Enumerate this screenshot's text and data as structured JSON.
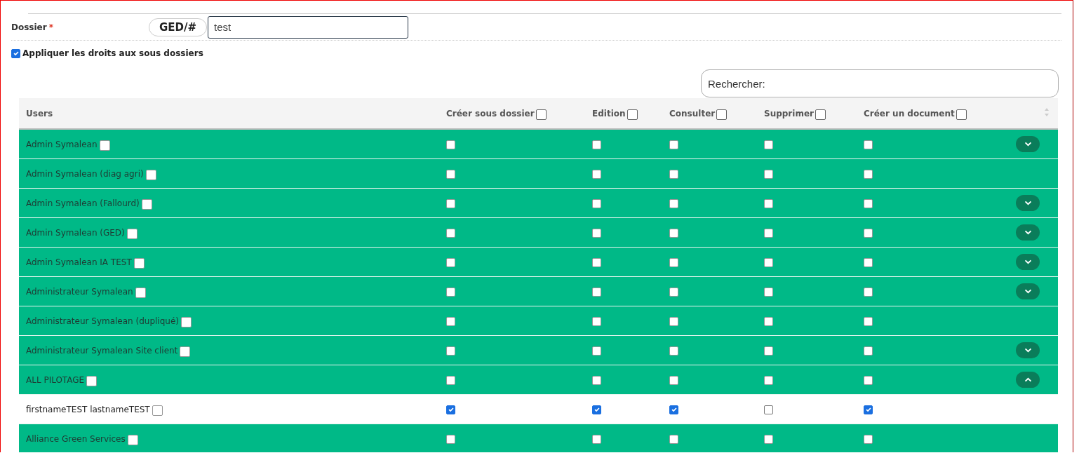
{
  "folder": {
    "label": "Dossier",
    "required_mark": "*",
    "prefix": "GED/#",
    "value": "test"
  },
  "apply_subfolders": {
    "label": "Appliquer les droits aux sous dossiers",
    "checked": true
  },
  "search": {
    "placeholder": "Rechercher:"
  },
  "table": {
    "columns": [
      {
        "label": "Users",
        "kind": "name"
      },
      {
        "label": "Créer sous dossier",
        "checked": false,
        "kind": "perm"
      },
      {
        "label": "Edition",
        "checked": false,
        "kind": "perm"
      },
      {
        "label": "Consulter",
        "checked": false,
        "kind": "perm"
      },
      {
        "label": "Supprimer",
        "checked": false,
        "kind": "perm"
      },
      {
        "label": "Créer un document",
        "checked": false,
        "kind": "perm"
      }
    ],
    "rows": [
      {
        "name": "Admin Symalean",
        "kind": "group",
        "checked": false,
        "perms": [
          false,
          false,
          false,
          false,
          false
        ],
        "expanded": false
      },
      {
        "name": "Admin Symalean (diag agri)",
        "kind": "group",
        "checked": false,
        "perms": [
          false,
          false,
          false,
          false,
          false
        ]
      },
      {
        "name": "Admin Symalean (Fallourd)",
        "kind": "group",
        "checked": false,
        "perms": [
          false,
          false,
          false,
          false,
          false
        ],
        "expanded": false
      },
      {
        "name": "Admin Symalean (GED)",
        "kind": "group",
        "checked": false,
        "perms": [
          false,
          false,
          false,
          false,
          false
        ],
        "expanded": false
      },
      {
        "name": "Admin Symalean IA TEST",
        "kind": "group",
        "checked": false,
        "perms": [
          false,
          false,
          false,
          false,
          false
        ],
        "expanded": false
      },
      {
        "name": "Administrateur Symalean",
        "kind": "group",
        "checked": false,
        "perms": [
          false,
          false,
          false,
          false,
          false
        ],
        "expanded": false
      },
      {
        "name": "Administrateur Symalean (dupliqué)",
        "kind": "group",
        "checked": false,
        "perms": [
          false,
          false,
          false,
          false,
          false
        ]
      },
      {
        "name": "Administrateur Symalean Site client",
        "kind": "group",
        "checked": false,
        "perms": [
          false,
          false,
          false,
          false,
          false
        ],
        "expanded": false
      },
      {
        "name": "ALL PILOTAGE",
        "kind": "group",
        "checked": false,
        "perms": [
          false,
          false,
          false,
          false,
          false
        ],
        "expanded": true
      },
      {
        "name": "firstnameTEST lastnameTEST",
        "kind": "user",
        "checked": false,
        "perms": [
          true,
          true,
          true,
          false,
          true
        ]
      },
      {
        "name": "Alliance Green Services",
        "kind": "group",
        "checked": false,
        "perms": [
          false,
          false,
          false,
          false,
          false
        ]
      }
    ]
  }
}
